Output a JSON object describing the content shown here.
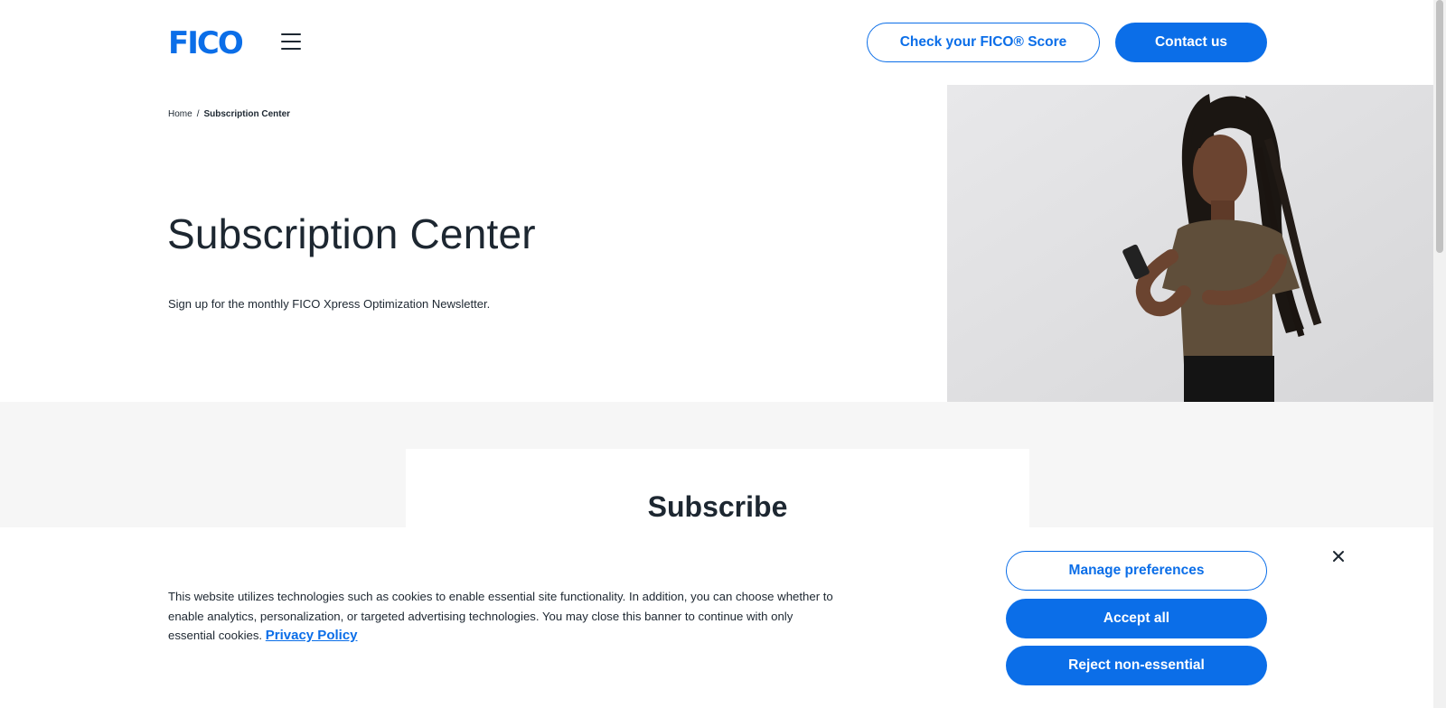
{
  "header": {
    "logo_text": "FICO",
    "check_score_label": "Check your FICO® Score",
    "contact_label": "Contact us"
  },
  "breadcrumb": {
    "home": "Home",
    "separator": "/",
    "current": "Subscription Center"
  },
  "main": {
    "title": "Subscription Center",
    "intro": "Sign up for the monthly FICO Xpress Optimization Newsletter."
  },
  "form": {
    "title": "Subscribe"
  },
  "cookie_banner": {
    "text": "This website utilizes technologies such as cookies to enable essential site functionality. In addition, you can choose whether to enable analytics, personalization, or targeted advertising technologies. You may close this banner to continue with only essential cookies.",
    "privacy_link": "Privacy Policy",
    "manage_label": "Manage preferences",
    "accept_label": "Accept all",
    "reject_label": "Reject non-essential"
  },
  "colors": {
    "brand_blue": "#0b6ee8",
    "text_dark": "#1d2731",
    "section_gray": "#f6f6f6"
  },
  "icons": [
    "hamburger-menu-icon",
    "close-icon"
  ]
}
